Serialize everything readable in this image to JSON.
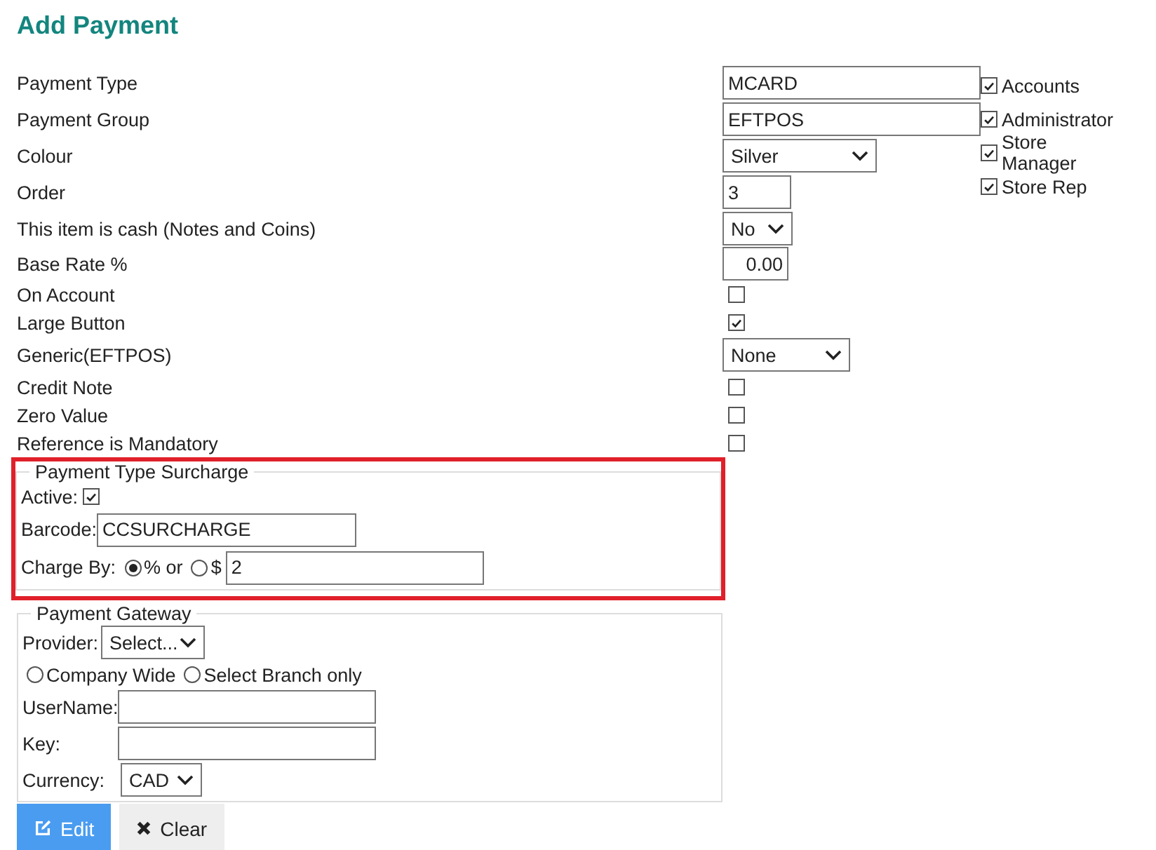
{
  "title": "Add Payment",
  "fields": [
    {
      "label": "Payment Type",
      "kind": "text",
      "value": "MCARD"
    },
    {
      "label": "Payment Group",
      "kind": "text",
      "value": "EFTPOS"
    },
    {
      "label": "Colour",
      "kind": "select",
      "value": "Silver"
    },
    {
      "label": "Order",
      "kind": "text",
      "value": "3"
    },
    {
      "label": "This item is cash (Notes and Coins)",
      "kind": "select",
      "value": "No"
    },
    {
      "label": "Base Rate %",
      "kind": "decimal",
      "value": "0.00"
    },
    {
      "label": "On Account",
      "kind": "checkbox",
      "checked": false
    },
    {
      "label": "Large Button",
      "kind": "checkbox",
      "checked": true
    },
    {
      "label": "Generic(EFTPOS)",
      "kind": "select",
      "value": "None"
    },
    {
      "label": "Credit Note",
      "kind": "checkbox",
      "checked": false
    },
    {
      "label": "Zero Value",
      "kind": "checkbox",
      "checked": false
    },
    {
      "label": "Reference is Mandatory",
      "kind": "checkbox",
      "checked": false
    }
  ],
  "roles": [
    {
      "label": "Accounts",
      "checked": true
    },
    {
      "label": "Administrator",
      "checked": true
    },
    {
      "label": "Store Manager",
      "checked": true
    },
    {
      "label": "Store Rep",
      "checked": true
    }
  ],
  "surcharge": {
    "legend": "Payment Type Surcharge",
    "highlighted": true,
    "active_label": "Active:",
    "active": true,
    "barcode_label": "Barcode:",
    "barcode": "CCSURCHARGE",
    "charge_label": "Charge By:",
    "options": [
      {
        "label": "% or",
        "selected": true
      },
      {
        "label": "$",
        "selected": false
      }
    ],
    "amount": "2"
  },
  "gateway": {
    "legend": "Payment Gateway",
    "provider_label": "Provider:",
    "provider": "Select...",
    "scope_options": [
      {
        "label": "Company Wide",
        "selected": false
      },
      {
        "label": "Select Branch only",
        "selected": false
      }
    ],
    "username_label": "UserName:",
    "key_label": "Key:",
    "currency_label": "Currency:",
    "currency": "CAD"
  },
  "buttons": [
    {
      "kind": "edit",
      "label": "Edit"
    },
    {
      "kind": "clear",
      "label": "Clear"
    }
  ]
}
